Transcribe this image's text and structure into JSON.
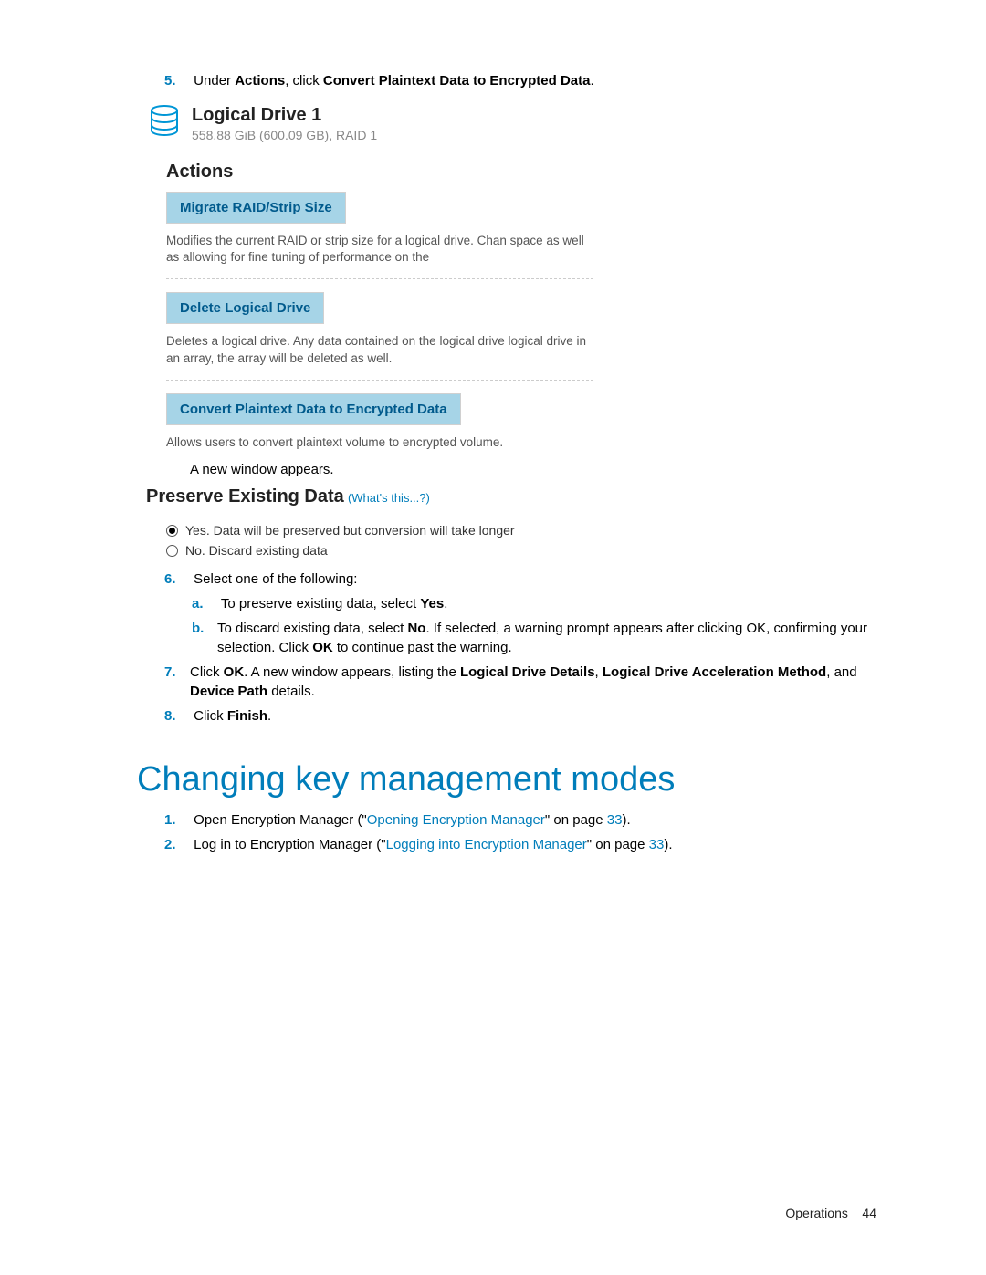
{
  "steps": {
    "s5_pre": "Under ",
    "s5_b1": "Actions",
    "s5_mid": ", click ",
    "s5_b2": "Convert Plaintext Data to Encrypted Data",
    "s5_post": ".",
    "s5_after": "A new window appears.",
    "s6": "Select one of the following:",
    "s6a_pre": "To preserve existing data, select ",
    "s6a_b": "Yes",
    "s6a_post": ".",
    "s6b_pre": "To discard existing data, select ",
    "s6b_b": "No",
    "s6b_mid": ". If selected, a warning prompt appears after clicking OK, confirming your selection. Click ",
    "s6b_b2": "OK",
    "s6b_post": " to continue past the warning.",
    "s7_pre": "Click ",
    "s7_b1": "OK",
    "s7_mid": ". A new window appears, listing the ",
    "s7_b2": "Logical Drive Details",
    "s7_mid2": ", ",
    "s7_b3": "Logical Drive Acceleration Method",
    "s7_mid3": ", and ",
    "s7_b4": "Device Path",
    "s7_post": " details.",
    "s8_pre": "Click ",
    "s8_b": "Finish",
    "s8_post": "."
  },
  "shot1": {
    "drive_title": "Logical Drive 1",
    "drive_sub": "558.88 GiB (600.09 GB), RAID 1",
    "actions_heading": "Actions",
    "migrate_label": "Migrate RAID/Strip Size",
    "migrate_desc": "Modifies the current RAID or strip size for a logical drive. Chan space as well as allowing for fine tuning of performance on the",
    "delete_label": "Delete Logical Drive",
    "delete_desc": "Deletes a logical drive. Any data contained on the logical drive logical drive in an array, the array will be deleted as well.",
    "convert_label": "Convert Plaintext Data to Encrypted Data",
    "convert_desc": "Allows users to convert plaintext volume to encrypted volume."
  },
  "shot2": {
    "heading": "Preserve Existing Data",
    "whats_this": "(What's this...?)",
    "opt_yes": "Yes. Data will be preserved but conversion will take longer",
    "opt_no": "No. Discard existing data"
  },
  "h2": "Changing key management modes",
  "ckm": {
    "s1_pre": "Open Encryption Manager (\"",
    "s1_link": "Opening Encryption Manager",
    "s1_post": "\" on page ",
    "s1_page": "33",
    "s1_end": ").",
    "s2_pre": "Log in to Encryption Manager (\"",
    "s2_link": "Logging into Encryption Manager",
    "s2_post": "\" on page ",
    "s2_page": "33",
    "s2_end": ")."
  },
  "footer": {
    "section": "Operations",
    "page": "44"
  },
  "nums": {
    "n5": "5.",
    "n6": "6.",
    "n7": "7.",
    "n8": "8.",
    "a": "a.",
    "b": "b.",
    "n1": "1.",
    "n2": "2."
  }
}
